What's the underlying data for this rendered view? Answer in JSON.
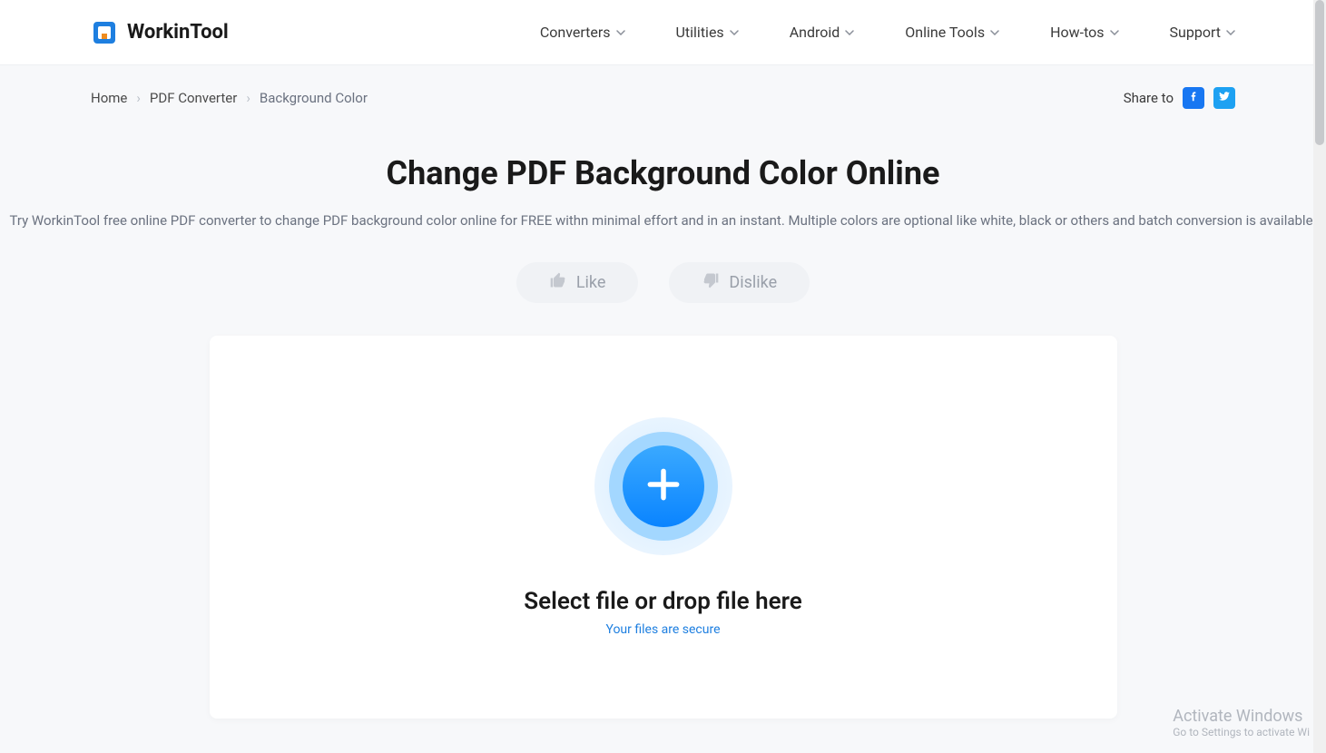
{
  "brand": {
    "name": "WorkinTool"
  },
  "nav": {
    "items": [
      {
        "label": "Converters"
      },
      {
        "label": "Utilities"
      },
      {
        "label": "Android"
      },
      {
        "label": "Online Tools"
      },
      {
        "label": "How-tos"
      },
      {
        "label": "Support"
      }
    ]
  },
  "breadcrumb": {
    "items": [
      {
        "label": "Home"
      },
      {
        "label": "PDF Converter"
      },
      {
        "label": "Background Color"
      }
    ]
  },
  "share": {
    "label": "Share to"
  },
  "page": {
    "title": "Change PDF Background Color Online",
    "desc": "Try WorkinTool free online PDF converter to change PDF background color online for FREE withn minimal effort and in an instant. Multiple colors are optional like white, black or others and batch conversion is available."
  },
  "vote": {
    "like": "Like",
    "dislike": "Dislike"
  },
  "upload": {
    "title": "Select file or drop file here",
    "secure": "Your files are secure"
  },
  "watermark": {
    "title": "Activate Windows",
    "sub": "Go to Settings to activate Wi"
  }
}
